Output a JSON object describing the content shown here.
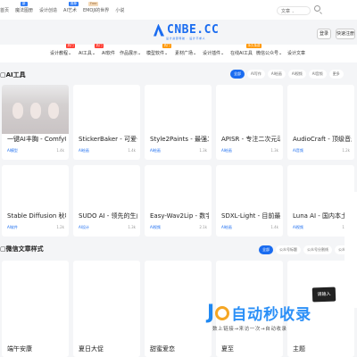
{
  "toplinks": [
    {
      "label": "首页"
    },
    {
      "label": "魔法图册",
      "tag": "新",
      "tag_color": "blue"
    },
    {
      "label": "设计创造"
    },
    {
      "label": "AI艺术",
      "tag": "推荐",
      "tag_color": "blue"
    },
    {
      "label": "EMOJI的世界",
      "tag": "Free",
      "tag_color": "beige"
    },
    {
      "label": "小说"
    }
  ],
  "logo": {
    "text": "CNBE.CC",
    "sub": "设计资源导航 · 设计不求人"
  },
  "search": {
    "label": "文章",
    "chev": "⌄"
  },
  "auth": {
    "login": "登录",
    "register": "快速注册"
  },
  "nav": [
    {
      "label": "设计教程",
      "chev": "⌄",
      "tag": "热门",
      "tag_color": "red"
    },
    {
      "label": "AI工具",
      "chev": "⌄",
      "tag": "热门",
      "tag_color": "red"
    },
    {
      "label": "AI软件"
    },
    {
      "label": "作品展示",
      "chev": "⌄"
    },
    {
      "label": "模型软件",
      "chev": "⌄",
      "tag": "热门",
      "tag_color": "orange"
    },
    {
      "label": "素材广场",
      "chev": "⌄"
    },
    {
      "label": "设计插件",
      "chev": "⌄"
    },
    {
      "label": "在线AI工具",
      "tag": "永久免费",
      "tag_color": "orange"
    },
    {
      "label": "微信公众号",
      "chev": "⌄"
    },
    {
      "label": "设计文章"
    }
  ],
  "ai_section": {
    "title": "AI工具",
    "tabs": [
      "全部",
      "AI写作",
      "AI绘画",
      "AI视频",
      "AI音频",
      "更多"
    ],
    "row1": [
      {
        "title": "一键AI丰胸 - ComfyUI…",
        "cat": "AI模型",
        "views": "1.4k"
      },
      {
        "title": "StickerBaker - 可爱卡通…",
        "cat": "AI绘画",
        "views": "1.4k"
      },
      {
        "title": "Style2Paints - 最强二次…",
        "cat": "AI绘画",
        "views": "1.3k"
      },
      {
        "title": "APISR - 专注二次元动漫…",
        "cat": "AI绘画",
        "views": "1.3k"
      },
      {
        "title": "AudioCraft - 顶级音乐…",
        "cat": "AI音频",
        "views": "1.2k"
      }
    ],
    "row2": [
      {
        "title": "Stable Diffusion 秋叶整…",
        "cat": "AI软件",
        "views": "1.2k"
      },
      {
        "title": "SUDO AI - 领先的生成…",
        "cat": "AI设计",
        "views": "1.3k"
      },
      {
        "title": "Easy-Wav2Lip - 数字人…",
        "cat": "AI视频",
        "views": "2.1k"
      },
      {
        "title": "SDXL-Light - 目前最快…",
        "cat": "AI绘画",
        "views": "1.4k"
      },
      {
        "title": "Luna AI - 国内本土顶级…",
        "cat": "AI视频",
        "views": "1.1k"
      }
    ]
  },
  "wx_section": {
    "title": "微信文章样式",
    "tabs": [
      "全部",
      "公众号标题",
      "公众号分割线",
      "公众号引导"
    ],
    "cards": [
      {
        "title": "端午安康"
      },
      {
        "title": "夏日大促"
      },
      {
        "title": "甜蜜爱恋"
      },
      {
        "title": "夏至"
      },
      {
        "title": "主题"
      }
    ]
  },
  "watermark": {
    "main": "自动秒收录",
    "sub": "数上链接→来访一次→自动收录",
    "vip": "请输入"
  }
}
